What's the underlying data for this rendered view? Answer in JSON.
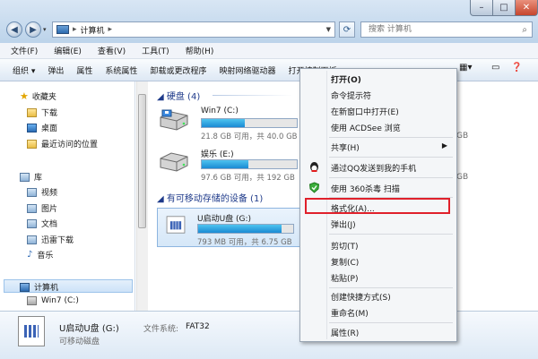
{
  "address": {
    "root_sep": "▸",
    "location": "计算机",
    "crumb_sep": "▸"
  },
  "search": {
    "placeholder": "搜索 计算机"
  },
  "menu": [
    "文件(F)",
    "编辑(E)",
    "查看(V)",
    "工具(T)",
    "帮助(H)"
  ],
  "toolbar": [
    "组织 ▾",
    "弹出",
    "属性",
    "系统属性",
    "卸载或更改程序",
    "映射网络驱动器",
    "打开控制面板"
  ],
  "nav": {
    "favorites": {
      "label": "收藏夹",
      "items": [
        "下载",
        "桌面",
        "最近访问的位置"
      ]
    },
    "libraries": {
      "label": "库",
      "items": [
        "视频",
        "图片",
        "文档",
        "迅雷下载",
        "音乐"
      ]
    },
    "computer": {
      "label": "计算机",
      "items": [
        "Win7 (C:)"
      ]
    }
  },
  "content": {
    "hdd_group": "硬盘 (4)",
    "removable_group": "有可移动存储的设备 (1)",
    "drives": [
      {
        "name": "Win7 (C:)",
        "info": "21.8 GB 可用，共 40.0 GB",
        "used_fraction": 0.45
      },
      {
        "name": "娱乐 (E:)",
        "info": "97.6 GB 可用，共 192 GB",
        "used_fraction": 0.49
      },
      {
        "name": "U启动U盘 (G:)",
        "info": "793 MB 可用，共 6.75 GB",
        "used_fraction": 0.88
      }
    ],
    "right_fragments": [
      "GB",
      "GB"
    ]
  },
  "details": {
    "title": "U启动U盘 (G:)",
    "fs_label": "文件系统:",
    "fs_value": "FAT32",
    "type": "可移动磁盘"
  },
  "context_menu": {
    "items": [
      {
        "label": "打开(O)"
      },
      {
        "label": "命令提示符"
      },
      {
        "label": "在新窗口中打开(E)"
      },
      {
        "label": "使用 ACDSee 浏览"
      },
      {
        "label": "共享(H)"
      },
      {
        "label": "通过QQ发送到我的手机"
      },
      {
        "label": "使用 360杀毒 扫描"
      },
      {
        "label": "格式化(A)..."
      },
      {
        "label": "弹出(J)"
      },
      {
        "label": "剪切(T)"
      },
      {
        "label": "复制(C)"
      },
      {
        "label": "粘贴(P)"
      },
      {
        "label": "创建快捷方式(S)"
      },
      {
        "label": "重命名(M)"
      },
      {
        "label": "属性(R)"
      }
    ]
  },
  "colors": {
    "highlight_border": "#e0202a",
    "progress": "#1a8ad4"
  }
}
